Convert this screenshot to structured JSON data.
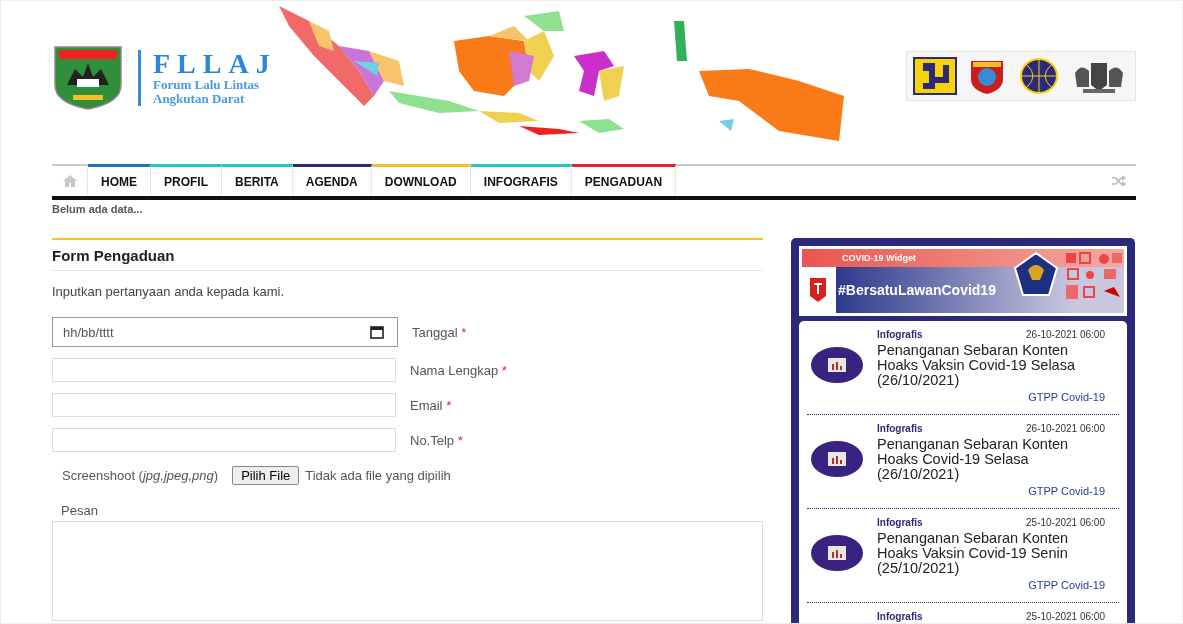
{
  "header": {
    "logo_title": "FLLAJ",
    "logo_subtitle_1": "Forum Lalu Lintas",
    "logo_subtitle_2": "Angkutan Darat"
  },
  "nav": {
    "items": [
      {
        "label": "HOME",
        "color": "#1e73be",
        "selected": false
      },
      {
        "label": "PROFIL",
        "color": "#1ec8c0",
        "selected": false
      },
      {
        "label": "BERITA",
        "color": "#1ec8c0",
        "selected": false
      },
      {
        "label": "AGENDA",
        "color": "#2b2a7a",
        "selected": false
      },
      {
        "label": "DOWNLOAD",
        "color": "#f5c02a",
        "selected": false
      },
      {
        "label": "INFOGRAFIS",
        "color": "#1ec8c0",
        "selected": false
      },
      {
        "label": "PENGADUAN",
        "color": "#e02424",
        "selected": false
      }
    ]
  },
  "ticker": "Belum ada data...",
  "form": {
    "title": "Form Pengaduan",
    "intro": "Inputkan pertanyaan anda kepada kami.",
    "fields": [
      {
        "kind": "date",
        "placeholder": "hh/bb/tttt",
        "label": "Tanggal",
        "mark": "*"
      },
      {
        "kind": "text",
        "label": "Nama Lengkap",
        "mark": "*"
      },
      {
        "kind": "text",
        "label": "Email",
        "mark": "*"
      },
      {
        "kind": "text",
        "label": "No.Telp",
        "mark": "*"
      }
    ],
    "file": {
      "label": "Screenshoot (*jpg,jpeg,png*)",
      "button": "Pilih File",
      "status": "Tidak ada file yang dipilih"
    },
    "message_label": "Pesan"
  },
  "widget": {
    "badge": "COVID-19 Widget",
    "hashtag": "#BersatuLawanCovid19",
    "news": [
      {
        "category": "Infografis",
        "date": "26-10-2021 06:00",
        "title": "Penanganan Sebaran Konten Hoaks Vaksin Covid-19 Selasa (26/10/2021)",
        "source": "GTPP Covid-19"
      },
      {
        "category": "Infografis",
        "date": "26-10-2021 06:00",
        "title": "Penanganan Sebaran Konten Hoaks Covid-19 Selasa (26/10/2021)",
        "source": "GTPP Covid-19"
      },
      {
        "category": "Infografis",
        "date": "25-10-2021 06:00",
        "title": "Penanganan Sebaran Konten Hoaks Vaksin Covid-19 Senin (25/10/2021)",
        "source": "GTPP Covid-19"
      },
      {
        "category": "Infografis",
        "date": "25-10-2021 06:00"
      }
    ]
  }
}
